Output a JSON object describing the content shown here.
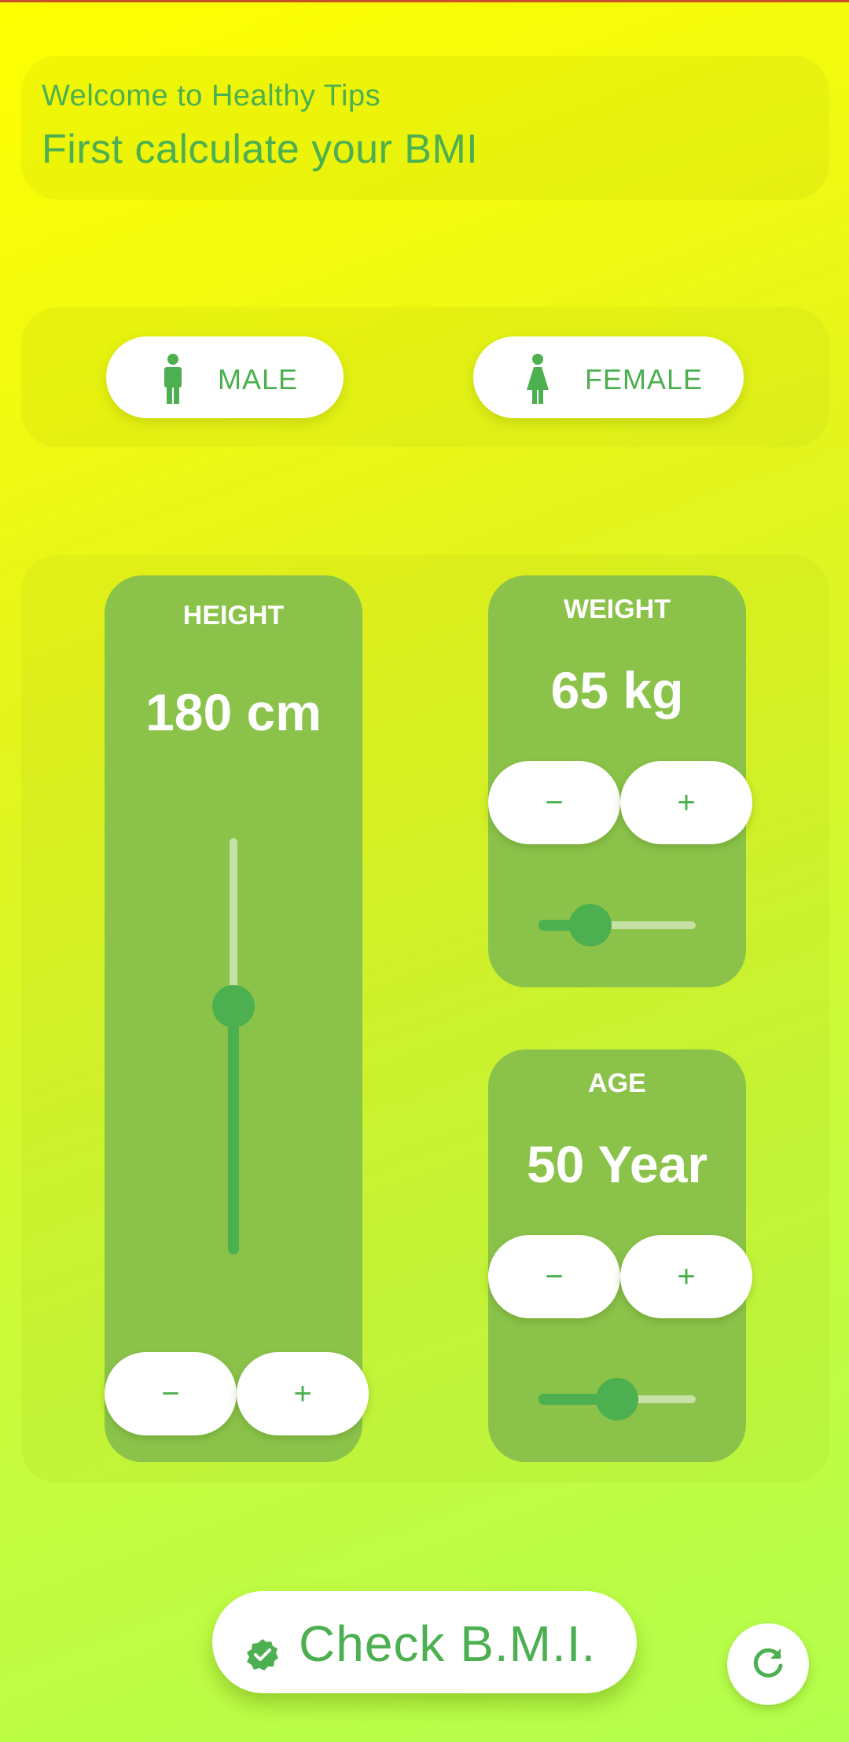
{
  "header": {
    "welcome": "Welcome to Healthy Tips",
    "headline": "First calculate your BMI"
  },
  "gender": {
    "male_label": "MALE",
    "female_label": "FEMALE"
  },
  "height": {
    "title": "HEIGHT",
    "value": "180 cm",
    "slider_fraction": 0.6,
    "minus": "−",
    "plus": "+"
  },
  "weight": {
    "title": "WEIGHT",
    "value": "65 kg",
    "slider_fraction": 0.35,
    "minus": "−",
    "plus": "+"
  },
  "age": {
    "title": "AGE",
    "value": "50 Year",
    "slider_fraction": 0.5,
    "minus": "−",
    "plus": "+"
  },
  "actions": {
    "check_label": "Check B.M.I.",
    "check_icon": "verified-check-icon",
    "refresh_icon": "refresh-icon"
  },
  "colors": {
    "accent": "#4caf50",
    "card": "#8bc34a",
    "track_inactive": "#c5e1a5"
  }
}
